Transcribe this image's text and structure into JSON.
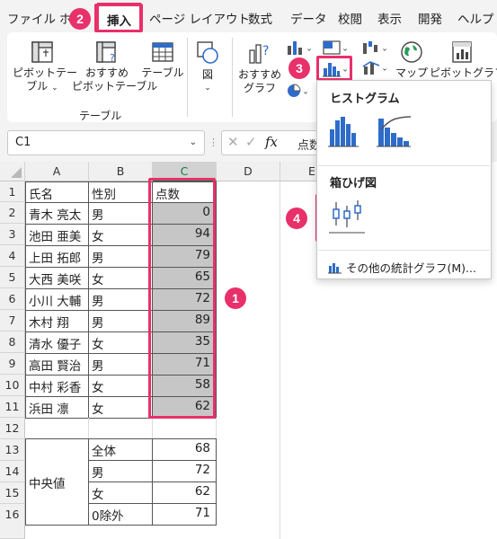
{
  "menu": {
    "tabs": [
      "ファイル",
      "ホ",
      "挿入",
      "ページ レイアウト",
      "数式",
      "データ",
      "校閲",
      "表示",
      "開発",
      "ヘルプ"
    ]
  },
  "ribbon": {
    "pivot_table": [
      "ピボットテー",
      "ブル"
    ],
    "recommended_pivot": [
      "おすすめ",
      "ピボットテーブル"
    ],
    "table": "テーブル",
    "illustrations": "図",
    "recommended_charts": [
      "おすすめ",
      "グラフ"
    ],
    "maps": "マップ",
    "pivot_chart": "ピボットグラフ",
    "group_tables": "テーブル"
  },
  "formula_bar": {
    "name_box": "C1",
    "fx": "fx",
    "formula_preview": "点数"
  },
  "sheet": {
    "columns": [
      "A",
      "B",
      "C",
      "D",
      "E"
    ],
    "rows": [
      "1",
      "2",
      "3",
      "4",
      "5",
      "6",
      "7",
      "8",
      "9",
      "10",
      "11",
      "12",
      "13",
      "14",
      "15",
      "16"
    ],
    "header": {
      "name": "氏名",
      "gender": "性別",
      "score": "点数"
    },
    "records": [
      {
        "name": "青木 亮太",
        "gender": "男",
        "score": "0"
      },
      {
        "name": "池田 亜美",
        "gender": "女",
        "score": "94"
      },
      {
        "name": "上田 拓郎",
        "gender": "男",
        "score": "79"
      },
      {
        "name": "大西 美咲",
        "gender": "女",
        "score": "65"
      },
      {
        "name": "小川 大輔",
        "gender": "男",
        "score": "72"
      },
      {
        "name": "木村 翔",
        "gender": "男",
        "score": "89"
      },
      {
        "name": "清水 優子",
        "gender": "女",
        "score": "35"
      },
      {
        "name": "高田 賢治",
        "gender": "男",
        "score": "71"
      },
      {
        "name": "中村 彩香",
        "gender": "女",
        "score": "58"
      },
      {
        "name": "浜田 凛",
        "gender": "女",
        "score": "62"
      }
    ],
    "median_label": "中央値",
    "median": [
      {
        "label": "全体",
        "value": "68"
      },
      {
        "label": "男",
        "value": "72"
      },
      {
        "label": "女",
        "value": "62"
      },
      {
        "label": "0除外",
        "value": "71"
      }
    ]
  },
  "dropdown": {
    "histogram_heading": "ヒストグラム",
    "boxplot_heading": "箱ひげ図",
    "more_charts": "その他の統計グラフ(M)..."
  },
  "badges": [
    "1",
    "2",
    "3",
    "4"
  ],
  "colors": {
    "accent_annotation": "#e8306b",
    "excel_green": "#107c41",
    "chart_blue": "#2f6cc9",
    "selection_fill": "#c6c6c6"
  }
}
